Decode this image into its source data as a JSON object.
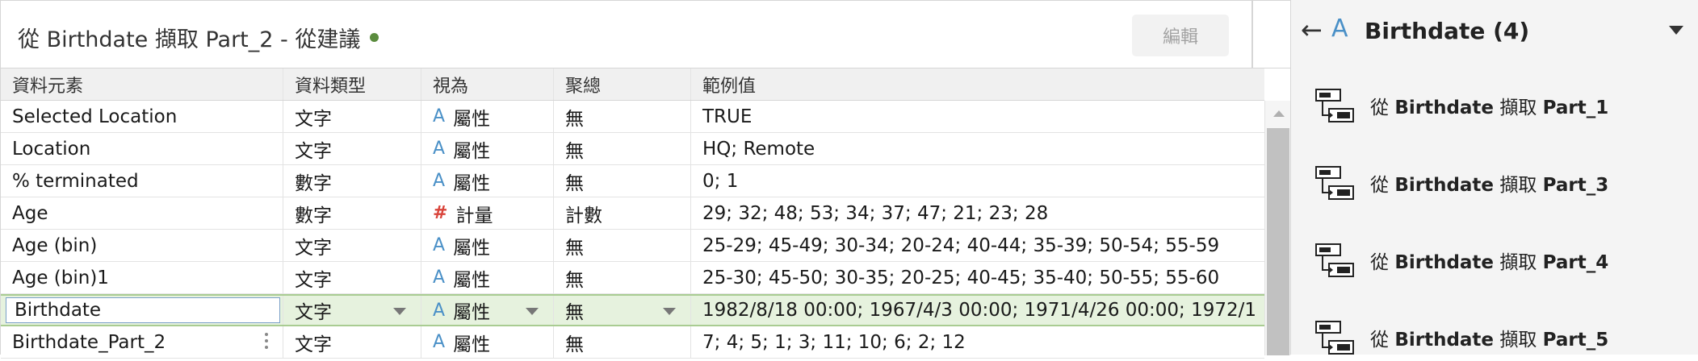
{
  "header": {
    "title": "從 Birthdate 擷取 Part_2 - 從建議",
    "edit_label": "編輯"
  },
  "table": {
    "columns": [
      "資料元素",
      "資料類型",
      "視為",
      "聚總",
      "範例值"
    ],
    "rows": [
      {
        "name": "Selected Location",
        "type": "文字",
        "role_icon": "A",
        "role": "屬性",
        "agg": "無",
        "sample": "TRUE"
      },
      {
        "name": "Location",
        "type": "文字",
        "role_icon": "A",
        "role": "屬性",
        "agg": "無",
        "sample": "HQ; Remote"
      },
      {
        "name": "% terminated",
        "type": "數字",
        "role_icon": "A",
        "role": "屬性",
        "agg": "無",
        "sample": "0; 1"
      },
      {
        "name": "Age",
        "type": "數字",
        "role_icon": "#",
        "role": "計量",
        "agg": "計數",
        "sample": "29; 32; 48; 53; 34; 37; 47; 21; 23; 28"
      },
      {
        "name": "Age (bin)",
        "type": "文字",
        "role_icon": "A",
        "role": "屬性",
        "agg": "無",
        "sample": "25-29; 45-49; 30-34; 20-24; 40-44; 35-39; 50-54; 55-59"
      },
      {
        "name": "Age (bin)1",
        "type": "文字",
        "role_icon": "A",
        "role": "屬性",
        "agg": "無",
        "sample": "25-30; 45-50; 30-35; 20-25; 40-45; 35-40; 50-55; 55-60"
      },
      {
        "name": "Birthdate",
        "type": "文字",
        "role_icon": "A",
        "role": "屬性",
        "agg": "無",
        "sample": "1982/8/18 00:00; 1967/4/3 00:00; 1971/4/26 00:00; 1972/1"
      },
      {
        "name": "Birthdate_Part_2",
        "type": "文字",
        "role_icon": "A",
        "role": "屬性",
        "agg": "無",
        "sample": "7; 4; 5; 1; 3; 11; 10; 6; 2; 12"
      }
    ]
  },
  "side_panel": {
    "type_icon": "A",
    "title": "Birthdate (4)",
    "items": [
      {
        "prefix": "從 ",
        "field": "Birthdate",
        "mid": " 擷取 ",
        "part": "Part_1"
      },
      {
        "prefix": "從 ",
        "field": "Birthdate",
        "mid": " 擷取 ",
        "part": "Part_3"
      },
      {
        "prefix": "從 ",
        "field": "Birthdate",
        "mid": " 擷取 ",
        "part": "Part_4"
      },
      {
        "prefix": "從 ",
        "field": "Birthdate",
        "mid": " 擷取 ",
        "part": "Part_5"
      }
    ]
  },
  "icons": {
    "back": "arrow-left-icon",
    "collapse": "chevron-down-icon",
    "recommendation": "split-field-icon",
    "string_type": "string-type-icon",
    "number_type": "number-type-icon"
  },
  "colors": {
    "status_dot": "#5b8c3e",
    "string_icon": "#4a90c7",
    "number_icon": "#d9443b",
    "selected_row": "#e6f2de"
  }
}
